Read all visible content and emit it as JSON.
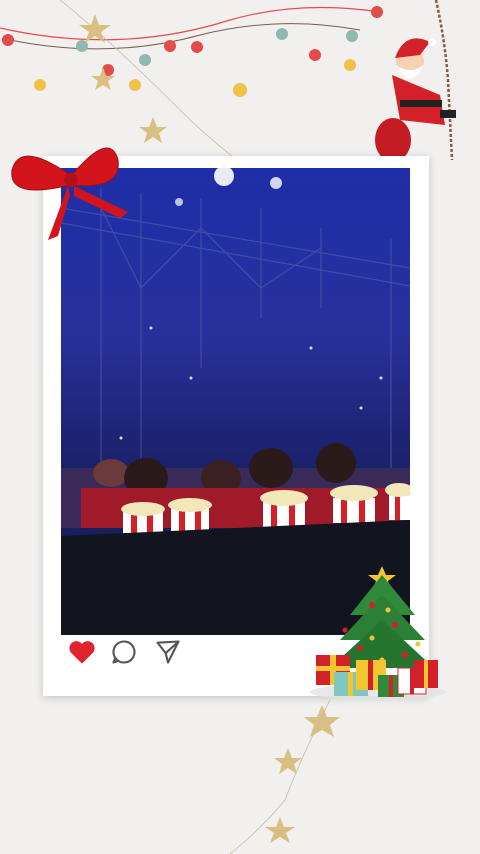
{
  "post": {
    "actions": [
      {
        "name": "like-button",
        "icon": "heart-icon",
        "liked": true
      },
      {
        "name": "comment-button",
        "icon": "comment-icon"
      },
      {
        "name": "share-button",
        "icon": "send-icon"
      }
    ]
  },
  "colors": {
    "background": "#f1f0ef",
    "like": "#e0242f",
    "icon_outline": "#555555",
    "ribbon": "#d4141c",
    "star": "#d9bf82",
    "stage_blue": "#2430a0"
  },
  "decorations": {
    "top_left": "string-lights-garland",
    "top_right": "santa-claus-climbing-rope",
    "card_corner": "red-ribbon-bow",
    "bottom_right": "christmas-tree-with-gifts",
    "bottom_center": "hanging-star-garland"
  }
}
